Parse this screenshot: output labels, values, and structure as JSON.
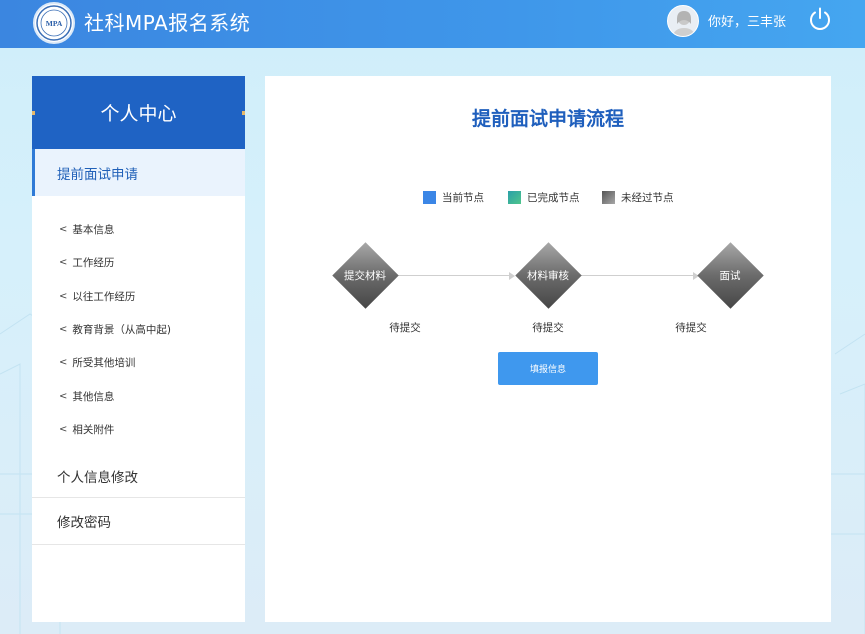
{
  "header": {
    "app_title": "社科MPA报名系统",
    "logo_text": "MPA",
    "greeting": "你好，三丰张"
  },
  "sidebar": {
    "title": "个人中心",
    "active_item": "提前面试申请",
    "sub_items": [
      {
        "label": "基本信息"
      },
      {
        "label": "工作经历"
      },
      {
        "label": "以往工作经历"
      },
      {
        "label": "教育背景（从高中起)"
      },
      {
        "label": "所受其他培训"
      },
      {
        "label": "其他信息"
      },
      {
        "label": "相关附件"
      }
    ],
    "sub_arrow": "<",
    "menu_items": [
      {
        "label": "个人信息修改"
      },
      {
        "label": "修改密码"
      }
    ]
  },
  "main": {
    "title": "提前面试申请流程",
    "legend": [
      {
        "label": "当前节点",
        "color": "#3b86e6"
      },
      {
        "label": "已完成节点",
        "color": "#3db49a"
      },
      {
        "label": "未经过节点",
        "color": "#6b6b6b"
      }
    ],
    "steps": [
      {
        "label": "提交材料",
        "status": "待提交"
      },
      {
        "label": "材料审核",
        "status": "待提交"
      },
      {
        "label": "面试",
        "status": "待提交"
      }
    ],
    "fill_button": "填报信息"
  },
  "colors": {
    "header_blue": "#3b86e0",
    "sidebar_blue": "#1f63c4",
    "title_blue": "#1f5fbd",
    "button_blue": "#3f98ee"
  }
}
